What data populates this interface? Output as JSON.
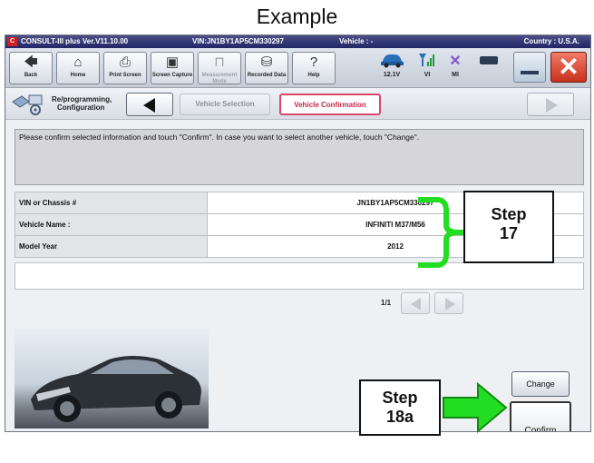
{
  "caption": "Example",
  "window": {
    "app_title": "CONSULT-III plus  Ver.V11.10.00",
    "vin_title": "VIN:JN1BY1AP5CM330297",
    "vehicle_title": "Vehicle : -",
    "country_title": "Country : U.S.A."
  },
  "toolbar": {
    "buttons": [
      {
        "label": "Back",
        "icon": "back-arrow-icon"
      },
      {
        "label": "Home",
        "icon": "home-icon"
      },
      {
        "label": "Print Screen",
        "icon": "printer-icon"
      },
      {
        "label": "Screen Capture",
        "icon": "camera-icon"
      },
      {
        "label": "Measurement Mode",
        "icon": "measurement-icon"
      },
      {
        "label": "Recorded Data",
        "icon": "recorded-data-icon"
      },
      {
        "label": "Help",
        "icon": "help-icon"
      }
    ],
    "battery_voltage": "12.1V",
    "vi_label": "VI",
    "mi_label": "MI"
  },
  "navbar": {
    "section_label_line1": "Re/programming,",
    "section_label_line2": "Configuration",
    "crumb_vehicle_selection": "Vehicle Selection",
    "crumb_vehicle_confirmation": "Vehicle Confirmation"
  },
  "message": "Please confirm selected information and touch \"Confirm\". In case you want to select another vehicle, touch \"Change\".",
  "vehicle_table": [
    {
      "label": "VIN or Chassis #",
      "value": "JN1BY1AP5CM330297"
    },
    {
      "label": "Vehicle Name :",
      "value": "INFINITI M37/M56"
    },
    {
      "label": "Model Year",
      "value": "2012"
    }
  ],
  "pager": "1/1",
  "buttons": {
    "change": "Change",
    "confirm": "Confirm"
  },
  "callouts": {
    "step17_line1": "Step",
    "step17_line2": "17",
    "step18a_line1": "Step",
    "step18a_line2": "18a"
  },
  "colors": {
    "title_bar": "#202566",
    "highlight_crumb": "#d9486a",
    "callout_green": "#22dd22"
  }
}
